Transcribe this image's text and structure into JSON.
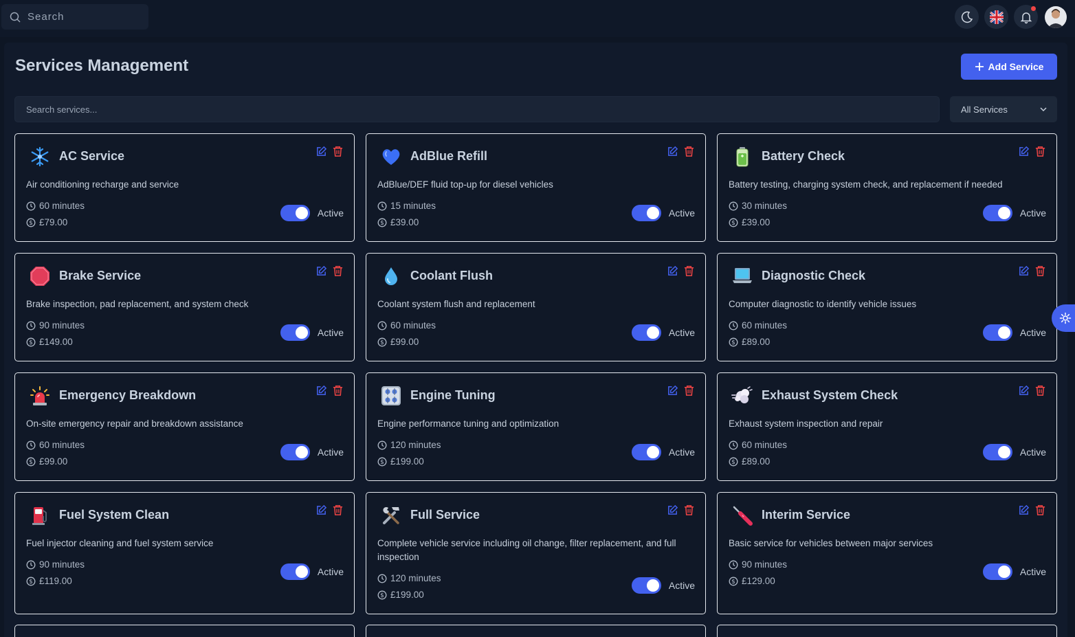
{
  "topbar": {
    "search_placeholder": "Search"
  },
  "page": {
    "title": "Services Management",
    "add_button": "Add Service",
    "search_placeholder": "Search services...",
    "filter_value": "All Services"
  },
  "colors": {
    "accent": "#4361ee",
    "delete": "#ef4444",
    "background": "#0e1624"
  },
  "services": [
    {
      "name": "AC Service",
      "icon": "snowflake-icon",
      "description": "Air conditioning recharge and service",
      "duration": "60 minutes",
      "price": "£79.00",
      "status": "Active",
      "active": true
    },
    {
      "name": "AdBlue Refill",
      "icon": "blue-heart-icon",
      "description": "AdBlue/DEF fluid top-up for diesel vehicles",
      "duration": "15 minutes",
      "price": "£39.00",
      "status": "Active",
      "active": true
    },
    {
      "name": "Battery Check",
      "icon": "battery-icon",
      "description": "Battery testing, charging system check, and replacement if needed",
      "duration": "30 minutes",
      "price": "£39.00",
      "status": "Active",
      "active": true
    },
    {
      "name": "Brake Service",
      "icon": "stop-sign-icon",
      "description": "Brake inspection, pad replacement, and system check",
      "duration": "90 minutes",
      "price": "£149.00",
      "status": "Active",
      "active": true
    },
    {
      "name": "Coolant Flush",
      "icon": "droplet-icon",
      "description": "Coolant system flush and replacement",
      "duration": "60 minutes",
      "price": "£99.00",
      "status": "Active",
      "active": true
    },
    {
      "name": "Diagnostic Check",
      "icon": "laptop-icon",
      "description": "Computer diagnostic to identify vehicle issues",
      "duration": "60 minutes",
      "price": "£89.00",
      "status": "Active",
      "active": true
    },
    {
      "name": "Emergency Breakdown",
      "icon": "siren-icon",
      "description": "On-site emergency repair and breakdown assistance",
      "duration": "60 minutes",
      "price": "£99.00",
      "status": "Active",
      "active": true
    },
    {
      "name": "Engine Tuning",
      "icon": "control-knobs-icon",
      "description": "Engine performance tuning and optimization",
      "duration": "120 minutes",
      "price": "£199.00",
      "status": "Active",
      "active": true
    },
    {
      "name": "Exhaust System Check",
      "icon": "exhaust-cloud-icon",
      "description": "Exhaust system inspection and repair",
      "duration": "60 minutes",
      "price": "£89.00",
      "status": "Active",
      "active": true
    },
    {
      "name": "Fuel System Clean",
      "icon": "fuel-pump-icon",
      "description": "Fuel injector cleaning and fuel system service",
      "duration": "90 minutes",
      "price": "£119.00",
      "status": "Active",
      "active": true
    },
    {
      "name": "Full Service",
      "icon": "hammer-wrench-icon",
      "description": "Complete vehicle service including oil change, filter replacement, and full inspection",
      "duration": "120 minutes",
      "price": "£199.00",
      "status": "Active",
      "active": true
    },
    {
      "name": "Interim Service",
      "icon": "screwdriver-icon",
      "description": "Basic service for vehicles between major services",
      "duration": "90 minutes",
      "price": "£129.00",
      "status": "Active",
      "active": true
    }
  ]
}
